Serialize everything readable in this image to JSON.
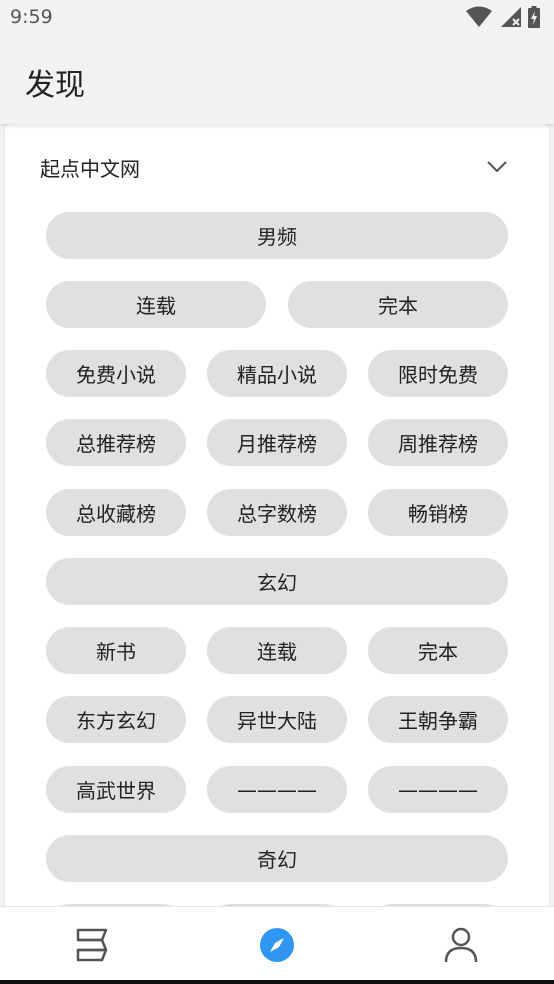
{
  "status_bar": {
    "time": "9:59"
  },
  "app_bar": {
    "title": "发现"
  },
  "source": {
    "title": "起点中文网",
    "expand_icon": "chevron-down-icon",
    "chips": [
      "男频",
      "连载",
      "完本",
      "免费小说",
      "精品小说",
      "限时免费",
      "总推荐榜",
      "月推荐榜",
      "周推荐榜",
      "总收藏榜",
      "总字数榜",
      "畅销榜",
      "玄幻",
      "新书",
      "连载",
      "完本",
      "东方玄幻",
      "异世大陆",
      "王朝争霸",
      "高武世界",
      "————",
      "————",
      "奇幻"
    ]
  },
  "bottom_nav": {
    "items": [
      {
        "icon": "bookshelf-icon"
      },
      {
        "icon": "compass-icon",
        "active": true
      },
      {
        "icon": "profile-icon"
      }
    ],
    "active_color": "#2f96f3",
    "inactive_color": "#555555"
  }
}
